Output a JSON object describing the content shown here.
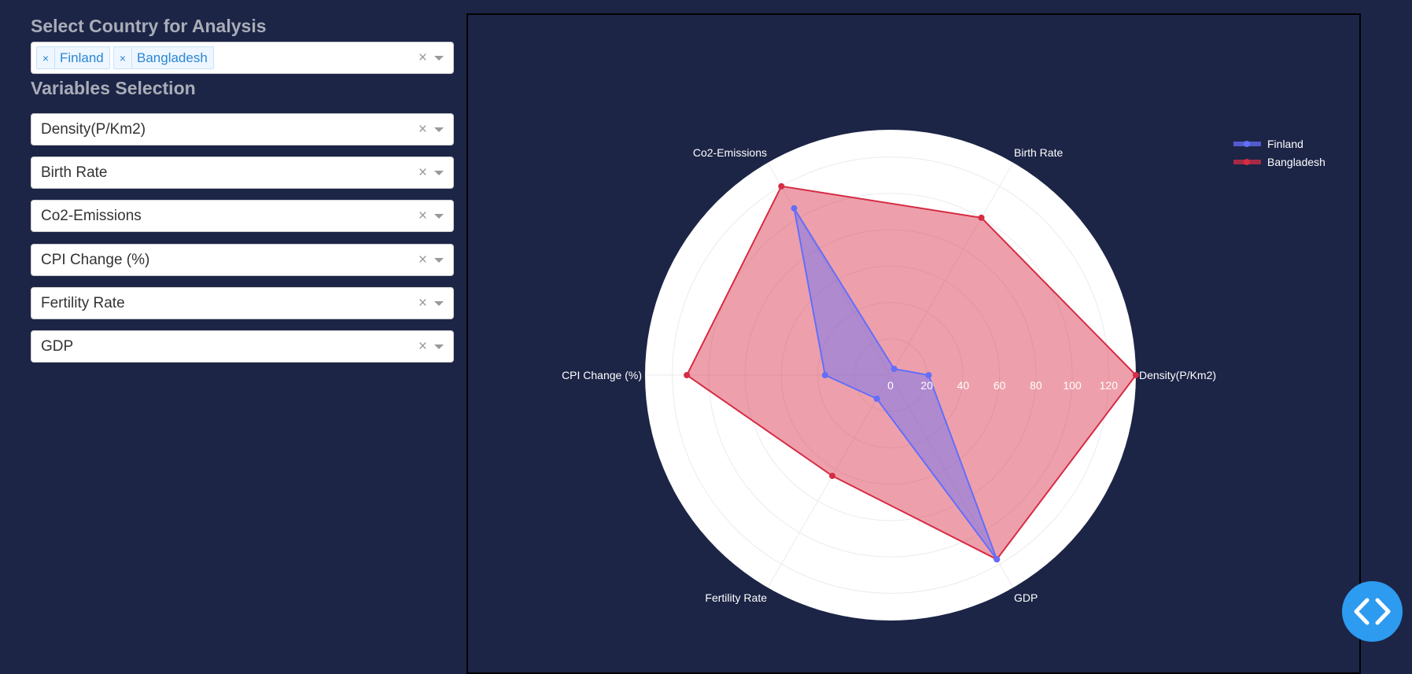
{
  "sidebar": {
    "country_title": "Select Country for Analysis",
    "country_tags": [
      "Finland",
      "Bangladesh"
    ],
    "variables_title": "Variables Selection",
    "variables": [
      "Density(P/Km2)",
      "Birth Rate",
      "Co2-Emissions",
      "CPI Change (%)",
      "Fertility Rate",
      "GDP"
    ],
    "clear_symbol": "×",
    "tag_remove_symbol": "×"
  },
  "icons": {
    "dropdown": "chevron-down-icon",
    "clear": "close-icon",
    "code_toggle": "code-brackets-icon"
  },
  "chart_data": {
    "type": "radar",
    "axes": [
      "Density(P/Km2)",
      "Birth Rate",
      "Co2-Emissions",
      "CPI Change (%)",
      "Fertility Rate",
      "GDP"
    ],
    "radial_range": [
      0,
      135
    ],
    "radial_ticks": [
      0,
      20,
      40,
      60,
      80,
      100,
      120
    ],
    "grid": true,
    "legend_position": "top-right",
    "series": [
      {
        "name": "Finland",
        "color": "#636efa",
        "values": [
          21,
          4,
          106,
          36,
          15,
          117
        ]
      },
      {
        "name": "Bangladesh",
        "color": "#d62c44",
        "fill": "rgba(214,44,68,0.45)",
        "values": [
          135,
          100,
          120,
          112,
          64,
          117
        ]
      }
    ]
  },
  "colors": {
    "background": "#1c2546",
    "polar_bg": "#ffffff",
    "finland": "#636efa",
    "bangladesh": "#d62c44"
  }
}
